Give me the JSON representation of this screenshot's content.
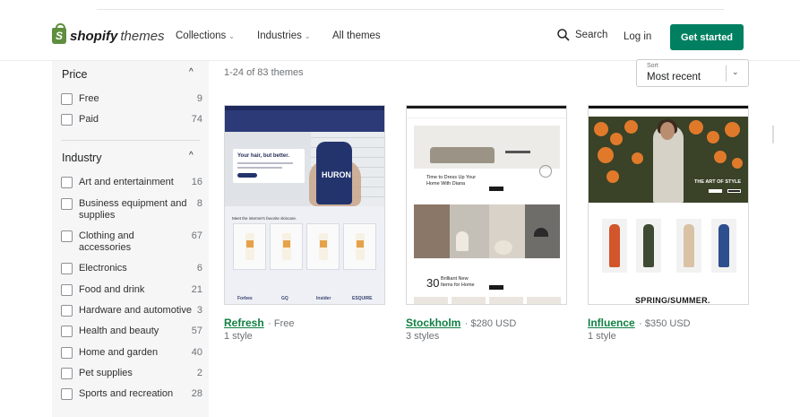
{
  "header": {
    "logo_brand": "shopify",
    "logo_sub": "themes",
    "nav": [
      {
        "label": "Collections",
        "chevron": "⌄"
      },
      {
        "label": "Industries",
        "chevron": "⌄"
      },
      {
        "label": "All themes"
      }
    ],
    "search_label": "Search",
    "login_label": "Log in",
    "cta_label": "Get started"
  },
  "sidebar": {
    "price": {
      "title": "Price",
      "caret": "^",
      "items": [
        {
          "label": "Free",
          "count": "9"
        },
        {
          "label": "Paid",
          "count": "74"
        }
      ]
    },
    "industry": {
      "title": "Industry",
      "caret": "^",
      "items": [
        {
          "label": "Art and entertainment",
          "count": "16"
        },
        {
          "label": "Business equipment and supplies",
          "count": "8"
        },
        {
          "label": "Clothing and accessories",
          "count": "67"
        },
        {
          "label": "Electronics",
          "count": "6"
        },
        {
          "label": "Food and drink",
          "count": "21"
        },
        {
          "label": "Hardware and automotive",
          "count": "3"
        },
        {
          "label": "Health and beauty",
          "count": "57"
        },
        {
          "label": "Home and garden",
          "count": "40"
        },
        {
          "label": "Pet supplies",
          "count": "2"
        },
        {
          "label": "Sports and recreation",
          "count": "28"
        }
      ]
    }
  },
  "main": {
    "results": "1-24 of 83 themes",
    "sort": {
      "label": "Sort",
      "value": "Most recent",
      "chevron": "⌄"
    },
    "themes": [
      {
        "name": "Refresh",
        "price": "· Free",
        "styles": "1 style",
        "preview": {
          "headline": "Your hair, but better.",
          "product": "HURON",
          "section": "Meet the internet's favorite skincare.",
          "logos": [
            "Forbes",
            "GQ",
            "Insider",
            "ESQUIRE"
          ]
        }
      },
      {
        "name": "Stockholm",
        "price": "· $280 USD",
        "styles": "3 styles",
        "preview": {
          "headline1": "Time to Dress Up Your",
          "headline2": "Home With Diana",
          "number": "30",
          "headline3": "Brilliant New",
          "headline4": "Items for Home"
        }
      },
      {
        "name": "Influence",
        "price": "· $350 USD",
        "styles": "1 style",
        "preview": {
          "hero": "THE ART OF STYLE",
          "season": "SPRING/SUMMER."
        }
      }
    ]
  },
  "colors": {
    "accent": "#008060",
    "link": "#108043",
    "refresh_navy": "#2c3a78",
    "influence_orange": "#e07a2a"
  }
}
